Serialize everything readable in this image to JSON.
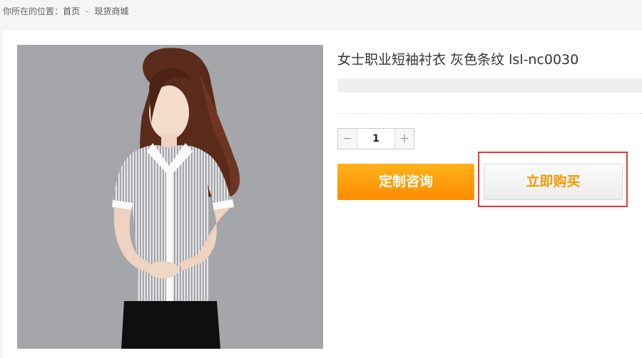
{
  "breadcrumb": {
    "prefix": "你所在的位置：",
    "home": "首页",
    "separator": "-",
    "current": "现货商城"
  },
  "product": {
    "title": "女士职业短袖衬衣 灰色条纹 lsl-nc0030",
    "quantity": "1",
    "minus_symbol": "－",
    "plus_symbol": "＋"
  },
  "buttons": {
    "consult_label": "定制咨询",
    "buy_label": "立即购买"
  },
  "colors": {
    "accent_orange": "#ff9a0a",
    "buy_text": "#f39800",
    "highlight_border": "#e53935"
  }
}
